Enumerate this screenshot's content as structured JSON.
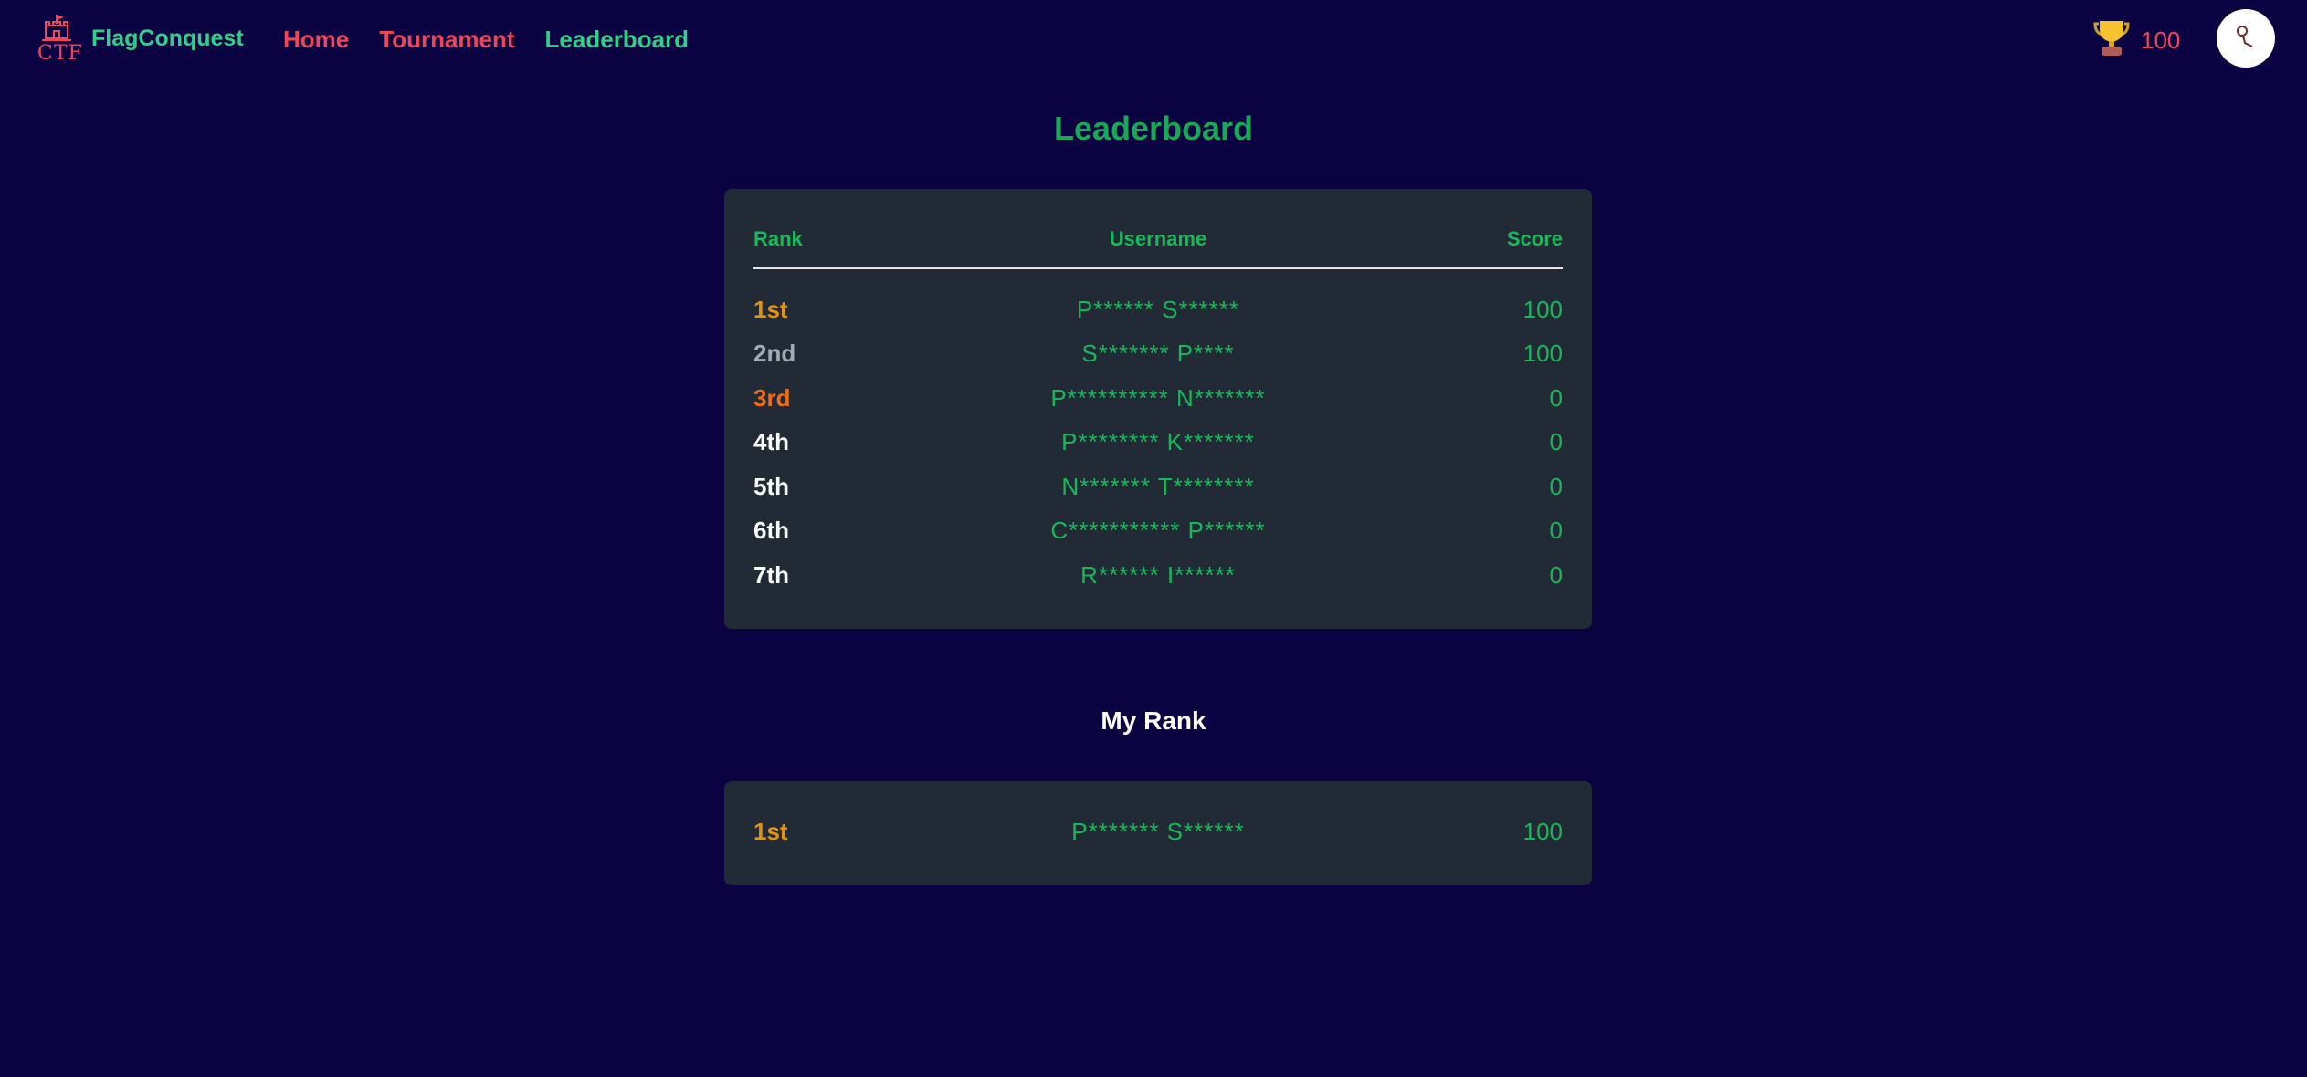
{
  "nav": {
    "brand": "FlagConquest",
    "logo_text": "CTF",
    "links": [
      {
        "label": "Home"
      },
      {
        "label": "Tournament"
      },
      {
        "label": "Leaderboard"
      }
    ],
    "points": "100",
    "points_icon": "trophy-icon",
    "avatar_icon": "user-avatar-icon"
  },
  "page": {
    "title": "Leaderboard"
  },
  "leaderboard": {
    "headers": {
      "rank": "Rank",
      "username": "Username",
      "score": "Score"
    },
    "rows": [
      {
        "rank": "1st",
        "username": "P****** S******",
        "score": "100"
      },
      {
        "rank": "2nd",
        "username": "S******* P****",
        "score": "100"
      },
      {
        "rank": "3rd",
        "username": "P********** N*******",
        "score": "0"
      },
      {
        "rank": "4th",
        "username": "P******** K*******",
        "score": "0"
      },
      {
        "rank": "5th",
        "username": "N******* T********",
        "score": "0"
      },
      {
        "rank": "6th",
        "username": "C*********** P******",
        "score": "0"
      },
      {
        "rank": "7th",
        "username": "R****** I******",
        "score": "0"
      }
    ]
  },
  "my_rank": {
    "title": "My Rank",
    "rank": "1st",
    "username": "P******* S******",
    "score": "100"
  },
  "colors": {
    "background": "#0b0242",
    "card": "#222b35",
    "accent_green": "#18b95c",
    "accent_red": "#f0465c",
    "gold": "#e3920e",
    "silver": "#a3aab3",
    "bronze": "#f26b16"
  }
}
